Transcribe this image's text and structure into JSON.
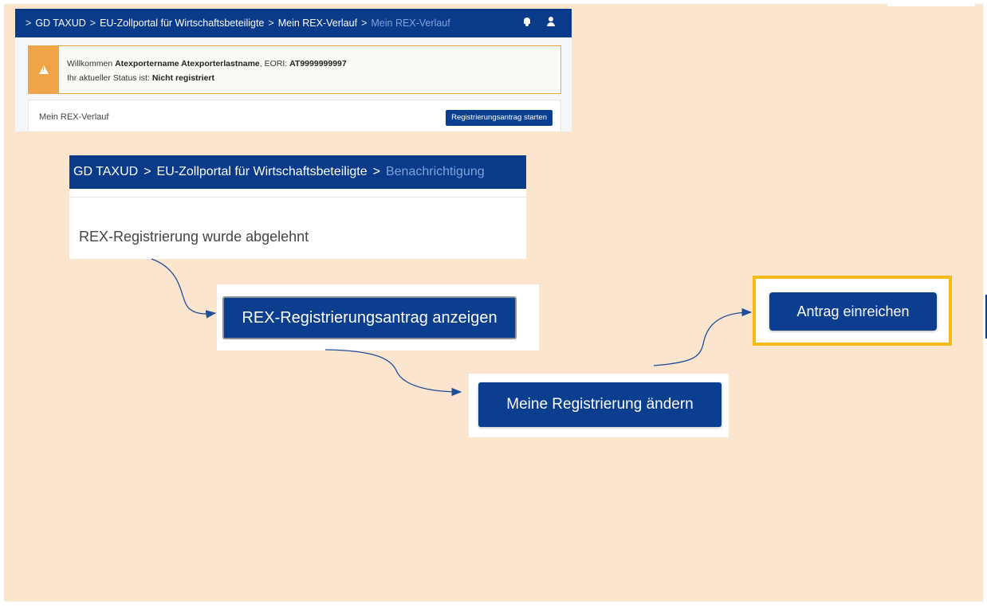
{
  "screenshot1": {
    "breadcrumb": [
      "GD TAXUD",
      "EU-Zollportal für Wirtschaftsbeteiligte",
      "Mein REX-Verlauf",
      "Mein REX-Verlauf"
    ],
    "alert": {
      "welcome_prefix": "Willkommen",
      "name": "Atexportername Atexporterlastname",
      "eori_label": ", EORI:",
      "eori": "AT9999999997",
      "status_prefix": "Ihr aktueller Status ist:",
      "status": "Nicht registriert"
    },
    "panel": {
      "title": "Mein REX-Verlauf",
      "button": "Registrierungsantrag starten"
    },
    "icons": [
      "bell-icon",
      "user-icon"
    ]
  },
  "screenshot2": {
    "breadcrumb": [
      "GD TAXUD",
      "EU-Zollportal für Wirtschaftsbeteiligte",
      "Benachrichtigung"
    ],
    "message": "REX-Registrierung wurde abgelehnt"
  },
  "buttons": {
    "show_application": "REX-Registrierungsantrag anzeigen",
    "change_registration": "Meine Registrierung ändern",
    "submit_application": "Antrag einreichen"
  },
  "colors": {
    "background": "#fbe5ce",
    "primary": "#0b3e8e",
    "warning": "#efa448",
    "highlight": "#f4ba19"
  }
}
